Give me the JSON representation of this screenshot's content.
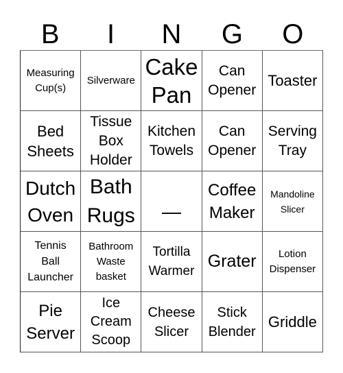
{
  "header": {
    "letters": [
      "B",
      "I",
      "N",
      "G",
      "O"
    ]
  },
  "board": {
    "rows": [
      [
        "Measuring\nCup(s)",
        "Silverware",
        "Cake\nPan",
        "Can\nOpener",
        "Toaster"
      ],
      [
        "Bed\nSheets",
        "Tissue\nBox\nHolder",
        "Kitchen\nTowels",
        "Can\nOpener",
        "Serving\nTray"
      ],
      [
        "Dutch\nOven",
        "Bath\nRugs",
        "—",
        "Coffee\nMaker",
        "Mandoline\nSlicer"
      ],
      [
        "Tennis\nBall\nLauncher",
        "Bathroom\nWaste\nbasket",
        "Tortilla\nWarmer",
        "Grater",
        "Lotion\nDispenser"
      ],
      [
        "Pie\nServer",
        "Ice\nCream\nScoop",
        "Cheese\nSlicer",
        "Stick\nBlender",
        "Griddle"
      ]
    ]
  }
}
